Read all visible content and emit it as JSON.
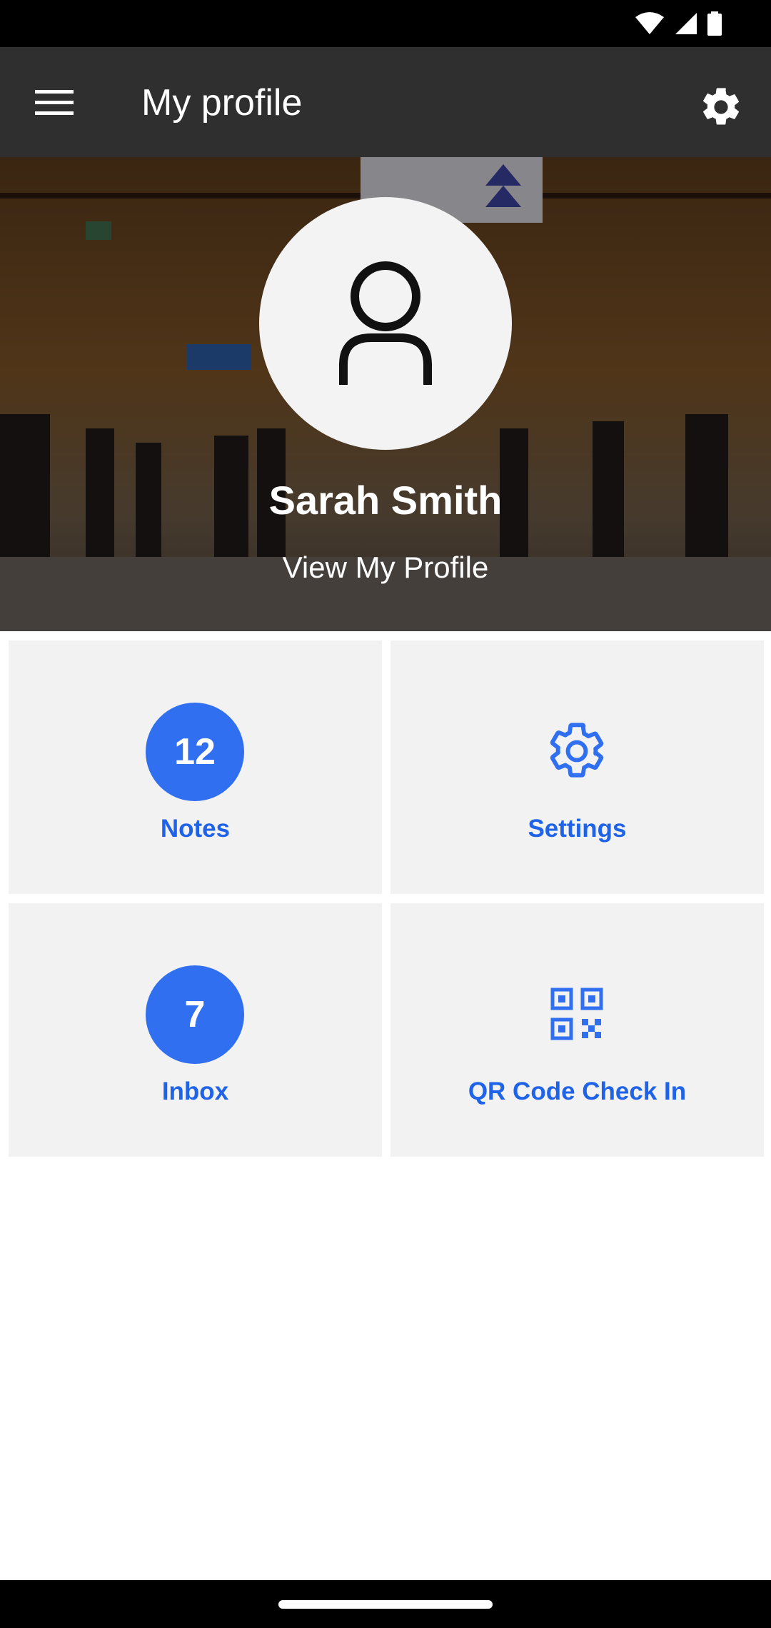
{
  "status_bar": {
    "icons": [
      "wifi-icon",
      "cellular-signal-icon",
      "battery-icon"
    ]
  },
  "app_bar": {
    "title": "My profile",
    "menu_icon": "hamburger-menu-icon",
    "settings_icon": "gear-icon"
  },
  "profile": {
    "name": "Sarah Smith",
    "link_label": "View My Profile",
    "avatar_icon": "person-outline-icon"
  },
  "tiles": [
    {
      "label": "Notes",
      "badge": "12"
    },
    {
      "label": "Settings",
      "icon": "gear-outline-icon"
    },
    {
      "label": "Inbox",
      "badge": "7"
    },
    {
      "label": "QR Code Check In",
      "icon": "qr-code-icon"
    }
  ],
  "colors": {
    "app_bar": "#2f2f2f",
    "accent": "#2f6ff0",
    "accent_text": "#1f63e8",
    "tile_bg": "#f2f2f2"
  }
}
